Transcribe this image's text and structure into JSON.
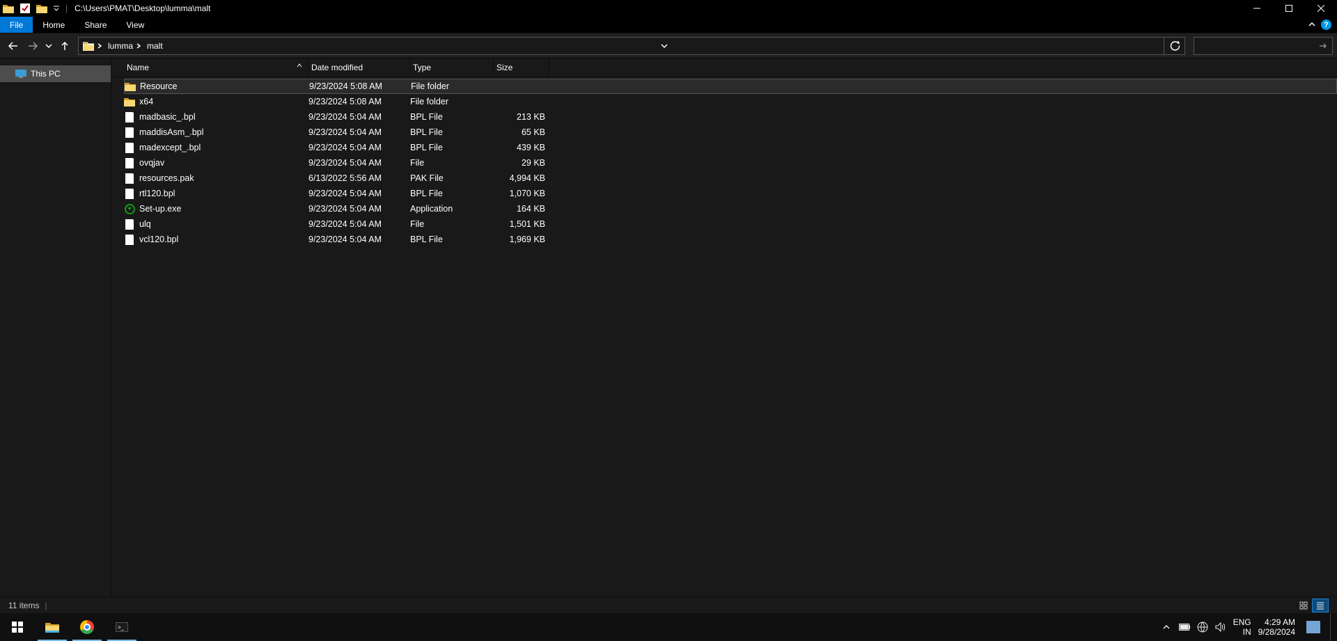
{
  "window": {
    "title_path": "C:\\Users\\PMAT\\Desktop\\lumma\\malt"
  },
  "ribbon": {
    "file": "File",
    "tabs": [
      "Home",
      "Share",
      "View"
    ]
  },
  "breadcrumbs": [
    "lumma",
    "malt"
  ],
  "sidebar": {
    "this_pc": "This PC"
  },
  "columns": {
    "name": "Name",
    "date": "Date modified",
    "type": "Type",
    "size": "Size"
  },
  "files": [
    {
      "icon": "folder",
      "name": "Resource",
      "date": "9/23/2024 5:08 AM",
      "type": "File folder",
      "size": "",
      "selected": true
    },
    {
      "icon": "folder",
      "name": "x64",
      "date": "9/23/2024 5:08 AM",
      "type": "File folder",
      "size": ""
    },
    {
      "icon": "file",
      "name": "madbasic_.bpl",
      "date": "9/23/2024 5:04 AM",
      "type": "BPL File",
      "size": "213 KB"
    },
    {
      "icon": "file",
      "name": "maddisAsm_.bpl",
      "date": "9/23/2024 5:04 AM",
      "type": "BPL File",
      "size": "65 KB"
    },
    {
      "icon": "file",
      "name": "madexcept_.bpl",
      "date": "9/23/2024 5:04 AM",
      "type": "BPL File",
      "size": "439 KB"
    },
    {
      "icon": "file",
      "name": "ovqjav",
      "date": "9/23/2024 5:04 AM",
      "type": "File",
      "size": "29 KB"
    },
    {
      "icon": "file",
      "name": "resources.pak",
      "date": "6/13/2022 5:56 AM",
      "type": "PAK File",
      "size": "4,994 KB"
    },
    {
      "icon": "file",
      "name": "rtl120.bpl",
      "date": "9/23/2024 5:04 AM",
      "type": "BPL File",
      "size": "1,070 KB"
    },
    {
      "icon": "setup",
      "name": "Set-up.exe",
      "date": "9/23/2024 5:04 AM",
      "type": "Application",
      "size": "164 KB"
    },
    {
      "icon": "file",
      "name": "ulq",
      "date": "9/23/2024 5:04 AM",
      "type": "File",
      "size": "1,501 KB"
    },
    {
      "icon": "file",
      "name": "vcl120.bpl",
      "date": "9/23/2024 5:04 AM",
      "type": "BPL File",
      "size": "1,969 KB"
    }
  ],
  "status": {
    "count_text": "11 items"
  },
  "tray": {
    "lang1": "ENG",
    "lang2": "IN",
    "time": "4:29 AM",
    "date": "9/28/2024"
  },
  "help_q": "?"
}
